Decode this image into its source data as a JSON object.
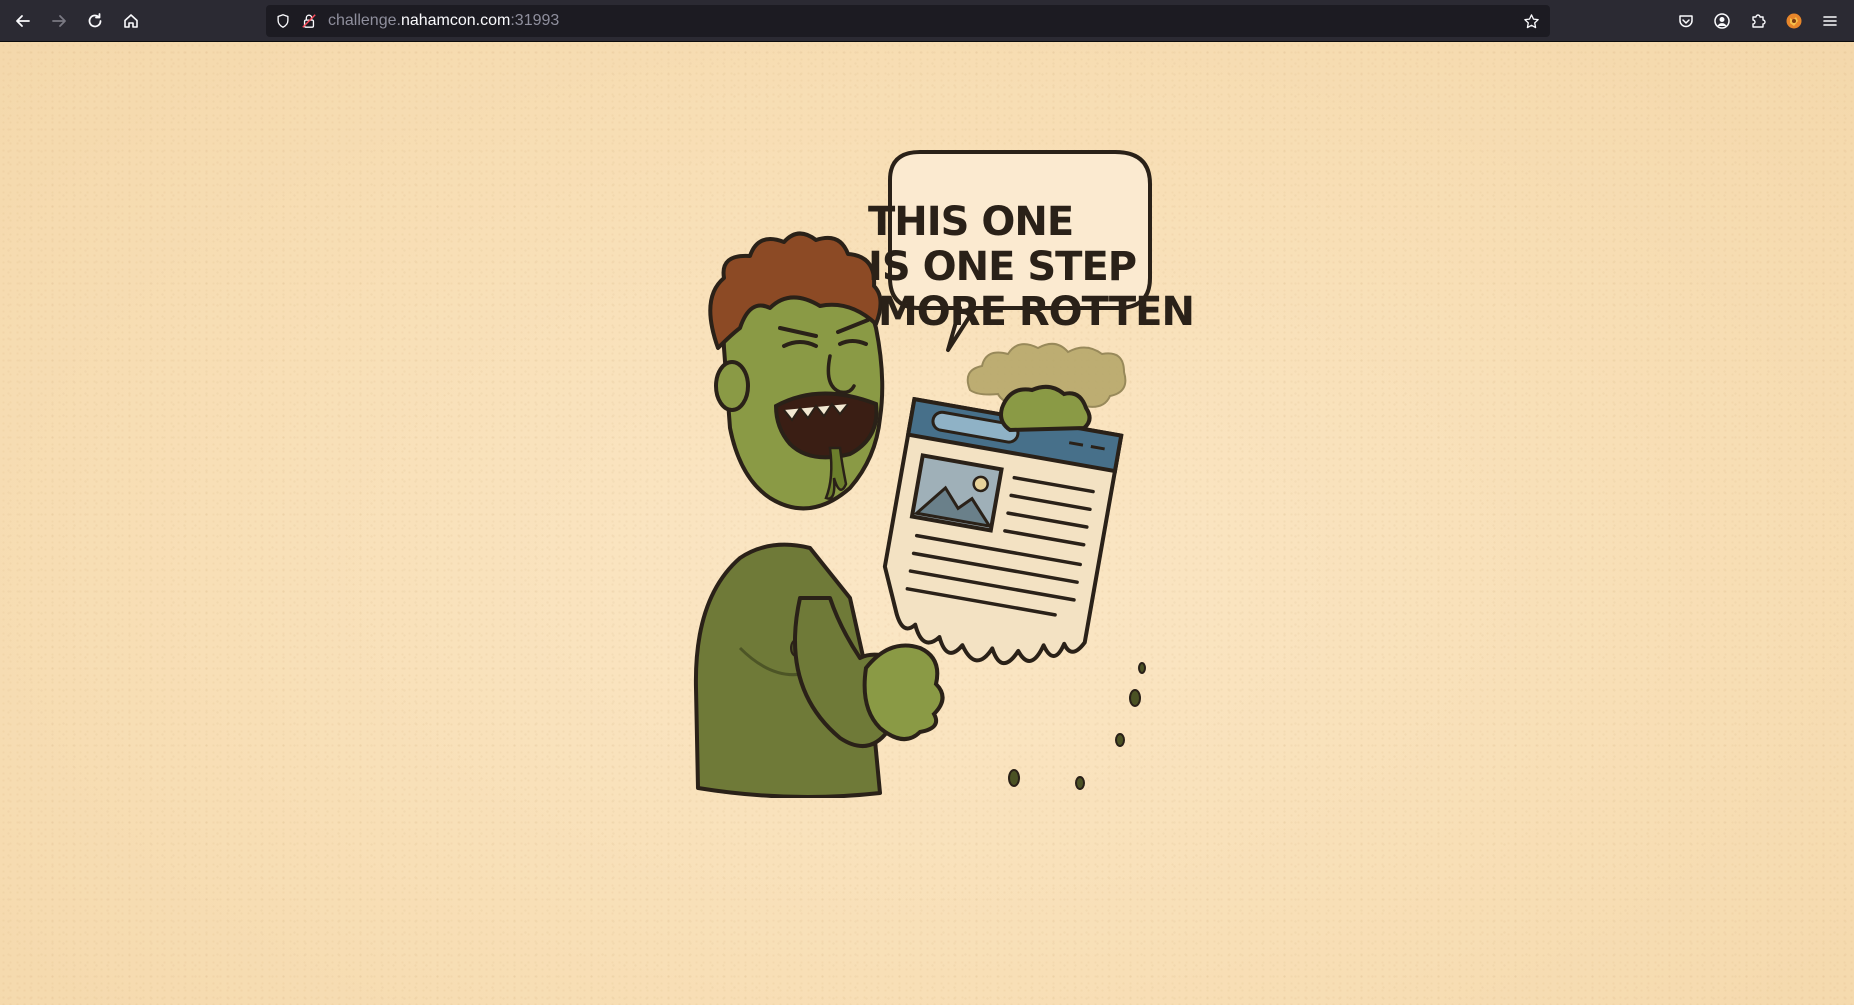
{
  "browser": {
    "url_scheme_host_prefix": "challenge.",
    "url_host": "nahamcon.com",
    "url_port": ":31993"
  },
  "page": {
    "speech_bubble": {
      "line1": "THIS ONE",
      "line2": "IS ONE STEP",
      "line3": "MORE ROTTEN"
    }
  }
}
